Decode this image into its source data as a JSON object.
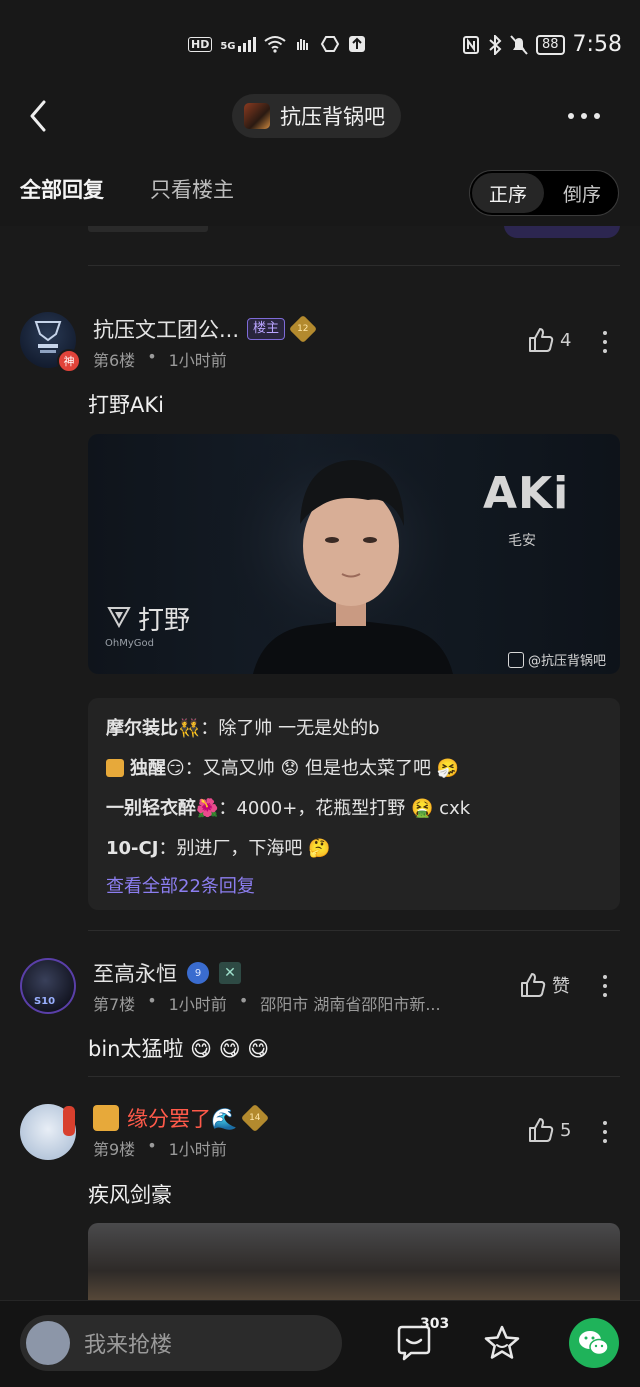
{
  "status_bar": {
    "network": "HD",
    "signal": "5G",
    "battery": "88",
    "time": "7:58"
  },
  "header": {
    "forum_name": "抗压背锅吧"
  },
  "tabs": {
    "all": "全部回复",
    "op_only": "只看楼主"
  },
  "order": {
    "forward": "正序",
    "reverse": "倒序"
  },
  "posts": [
    {
      "username": "抗压文工团公...",
      "op_badge": "楼主",
      "level": "12",
      "avatar_badge": "神",
      "floor": "第6楼",
      "time": "1小时前",
      "likes": "4",
      "text": "打野AKi",
      "image": {
        "player": "AKi",
        "name_cn": "毛安",
        "role": "打野",
        "team": "OhMyGod",
        "watermark": "@抗压背锅吧"
      },
      "sub_replies": [
        {
          "user": "摩尔装比👯",
          "text": "除了帅 一无是处的b"
        },
        {
          "user": "独醒😏",
          "text": "又高又帅 😟 但是也太菜了吧 🤧"
        },
        {
          "user": "一别轻衣醉🌺",
          "text": "4000+，花瓶型打野 🤮 cxk"
        },
        {
          "user": "10-CJ",
          "text": "别进厂，下海吧 🤔"
        }
      ],
      "see_all": "查看全部22条回复"
    },
    {
      "username": "至高永恒",
      "avatar_badge": "S10",
      "level": "9",
      "floor": "第7楼",
      "time": "1小时前",
      "location": "邵阳市 湖南省邵阳市新...",
      "likes": "赞",
      "text": "bin太猛啦 😋 😋 😋"
    },
    {
      "username": "缘分罢了🌊",
      "level": "14",
      "floor": "第9楼",
      "time": "1小时前",
      "likes": "5",
      "text": "疾风剑豪"
    }
  ],
  "bottom": {
    "placeholder": "我来抢楼",
    "comment_count": "303"
  },
  "colors": {
    "accent_purple": "#8c7ef0",
    "wechat_green": "#1fb35a",
    "vip_red": "#ff5a4a"
  }
}
